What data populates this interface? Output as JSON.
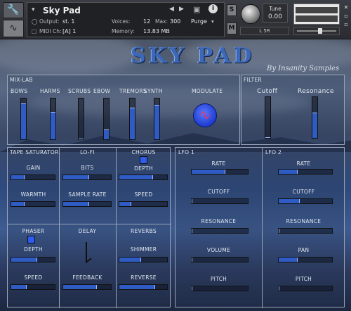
{
  "header": {
    "instrument_name": "Sky Pad",
    "output_label": "Output:",
    "output_value": "st. 1",
    "midi_label": "MIDI Ch:",
    "midi_value": "[A] 1",
    "voices_label": "Voices:",
    "voices_value": "12",
    "max_label": "Max:",
    "max_value": "300",
    "memory_label": "Memory:",
    "memory_value": "13.83 MB",
    "purge_label": "Purge",
    "info_icon": "i",
    "s_label": "S",
    "m_label": "M",
    "tune_label": "Tune",
    "tune_value": "0.00",
    "pan_label": "L 5R"
  },
  "title": "SKY PAD",
  "byline": "By Insanity Samples",
  "mixlab": {
    "section_label": "MIX-LAB",
    "channels": [
      {
        "label": "BOWS",
        "level": 0.88
      },
      {
        "label": "HARMS",
        "level": 0.68
      },
      {
        "label": "SCRUBS",
        "level": 0.0
      },
      {
        "label": "EBOW",
        "level": 0.25
      },
      {
        "label": "TREMORS",
        "level": 0.78
      },
      {
        "label": "SYNTH",
        "level": 0.85
      }
    ],
    "modulate_label": "MODULATE"
  },
  "filter": {
    "section_label": "FILTER",
    "cutoff_label": "Cutoff",
    "cutoff_level": 0.0,
    "resonance_label": "Resonance",
    "resonance_level": 0.62
  },
  "tape": {
    "section_label": "TAPE SATURATOR",
    "gain_label": "GAIN",
    "gain": 0.3,
    "warmth_label": "WARMTH",
    "warmth": 0.3
  },
  "lofi": {
    "section_label": "LO-FI",
    "bits_label": "BITS",
    "bits": 0.55,
    "sample_rate_label": "SAMPLE RATE",
    "sample_rate": 0.55
  },
  "chorus": {
    "section_label": "CHORUS",
    "depth_label": "DEPTH",
    "depth": 0.7,
    "speed_label": "SPEED",
    "speed": 0.25
  },
  "phaser": {
    "section_label": "PHASER",
    "depth_label": "DEPTH",
    "depth": 0.6,
    "speed_label": "SPEED",
    "speed": 0.35
  },
  "delay": {
    "section_label": "DELAY",
    "feedback_label": "FEEDBACK",
    "feedback": 0.7
  },
  "reverbs": {
    "section_label": "REVERBS",
    "shimmer_label": "SHIMMER",
    "shimmer": 0.45,
    "reverse_label": "REVERSE",
    "reverse": 0.75
  },
  "lfo1": {
    "section_label": "LFO 1",
    "rate_label": "RATE",
    "rate": 0.6,
    "cutoff_label": "CUTOFF",
    "cutoff": 0.0,
    "resonance_label": "RESONANCE",
    "resonance": 0.0,
    "volume_label": "VOLUME",
    "volume": 0.0,
    "pitch_label": "PITCH",
    "pitch": 0.0
  },
  "lfo2": {
    "section_label": "LFO 2",
    "rate_label": "RATE",
    "rate": 0.35,
    "cutoff_label": "CUTOFF",
    "cutoff": 0.4,
    "resonance_label": "RESONANCE",
    "resonance": 0.0,
    "pan_label": "PAN",
    "pan": 0.35,
    "pitch_label": "PITCH",
    "pitch": 0.0
  },
  "colors": {
    "accent": "#2f5cc4",
    "title": "#3b68b8",
    "panel_border": "#9aa6b8"
  },
  "icons": [
    "wrench-icon",
    "waveform-icon",
    "camera-icon",
    "info-icon",
    "prev-arrow-icon",
    "next-arrow-icon",
    "dropdown-arrow-icon"
  ]
}
